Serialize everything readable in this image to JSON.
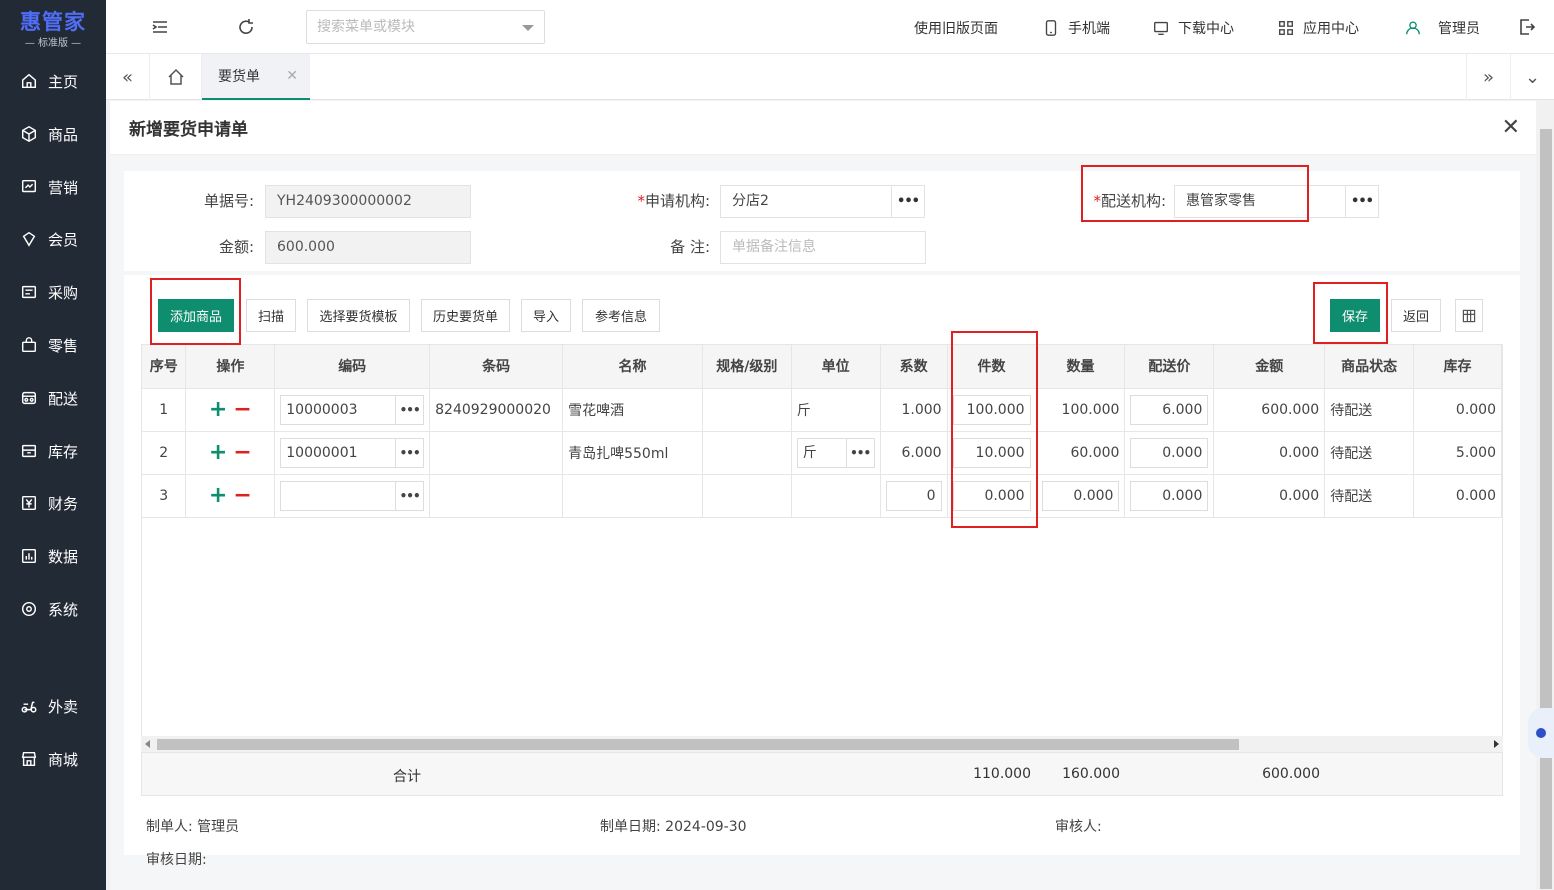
{
  "sidebar": {
    "brand": "惠管家",
    "edition": "— 标准版 —",
    "items": [
      {
        "label": "主页",
        "icon": "home-icon"
      },
      {
        "label": "商品",
        "icon": "box-icon"
      },
      {
        "label": "营销",
        "icon": "chart-icon"
      },
      {
        "label": "会员",
        "icon": "diamond-icon"
      },
      {
        "label": "采购",
        "icon": "purchase-icon"
      },
      {
        "label": "零售",
        "icon": "bag-icon"
      },
      {
        "label": "配送",
        "icon": "delivery-icon"
      },
      {
        "label": "库存",
        "icon": "warehouse-icon"
      },
      {
        "label": "财务",
        "icon": "yen-icon"
      },
      {
        "label": "数据",
        "icon": "data-icon"
      },
      {
        "label": "系统",
        "icon": "settings-icon"
      },
      {
        "label": "外卖",
        "icon": "scooter-icon"
      },
      {
        "label": "商城",
        "icon": "store-icon"
      }
    ]
  },
  "topbar": {
    "search_placeholder": "搜索菜单或模块",
    "old_page": "使用旧版页面",
    "mobile": "手机端",
    "download": "下载中心",
    "apps": "应用中心",
    "user": "管理员"
  },
  "tabs": {
    "active": "要货单"
  },
  "dialog": {
    "title": "新增要货申请单"
  },
  "form": {
    "doc_no_label": "单据号:",
    "doc_no": "YH2409300000002",
    "amount_label": "金额:",
    "amount": "600.000",
    "apply_org_label": "申请机构:",
    "apply_org": "分店2",
    "remark_label": "备  注:",
    "remark_placeholder": "单据备注信息",
    "delivery_org_label": "配送机构:",
    "delivery_org": "惠管家零售",
    "required_mark": "*"
  },
  "toolbar": {
    "add_goods": "添加商品",
    "scan": "扫描",
    "select_template": "选择要货模板",
    "history": "历史要货单",
    "import": "导入",
    "reference": "参考信息",
    "save": "保存",
    "back": "返回"
  },
  "table": {
    "columns": [
      "序号",
      "操作",
      "编码",
      "条码",
      "名称",
      "规格/级别",
      "单位",
      "系数",
      "件数",
      "数量",
      "配送价",
      "金额",
      "商品状态",
      "库存"
    ],
    "op_plus": "+",
    "op_minus": "−",
    "rows": [
      {
        "no": "1",
        "code": "10000003",
        "barcode": "8240929000020",
        "name": "雪花啤酒",
        "spec": "",
        "unit": "斤",
        "factor": "1.000",
        "pieces": "100.000",
        "qty": "100.000",
        "price": "6.000",
        "amount": "600.000",
        "status": "待配送",
        "stock": "0.000"
      },
      {
        "no": "2",
        "code": "10000001",
        "barcode": "",
        "name": "青岛扎啤550ml",
        "spec": "",
        "unit": "斤",
        "factor": "6.000",
        "pieces": "10.000",
        "qty": "60.000",
        "price": "0.000",
        "amount": "0.000",
        "status": "待配送",
        "stock": "5.000"
      },
      {
        "no": "3",
        "code": "",
        "barcode": "",
        "name": "",
        "spec": "",
        "unit": "",
        "factor": "0",
        "pieces": "0.000",
        "qty": "0.000",
        "price": "0.000",
        "amount": "0.000",
        "status": "待配送",
        "stock": "0.000"
      }
    ],
    "summary": {
      "label": "合计",
      "pieces": "110.000",
      "qty": "160.000",
      "amount": "600.000"
    }
  },
  "footer": {
    "creator_label": "制单人:",
    "creator": "管理员",
    "date_label": "制单日期:",
    "date": "2024-09-30",
    "auditor_label": "审核人:",
    "audit_date_label": "审核日期:"
  },
  "colors": {
    "primary": "#0e8e6e",
    "highlight": "#e02020",
    "sidebar_bg": "#222a36"
  }
}
